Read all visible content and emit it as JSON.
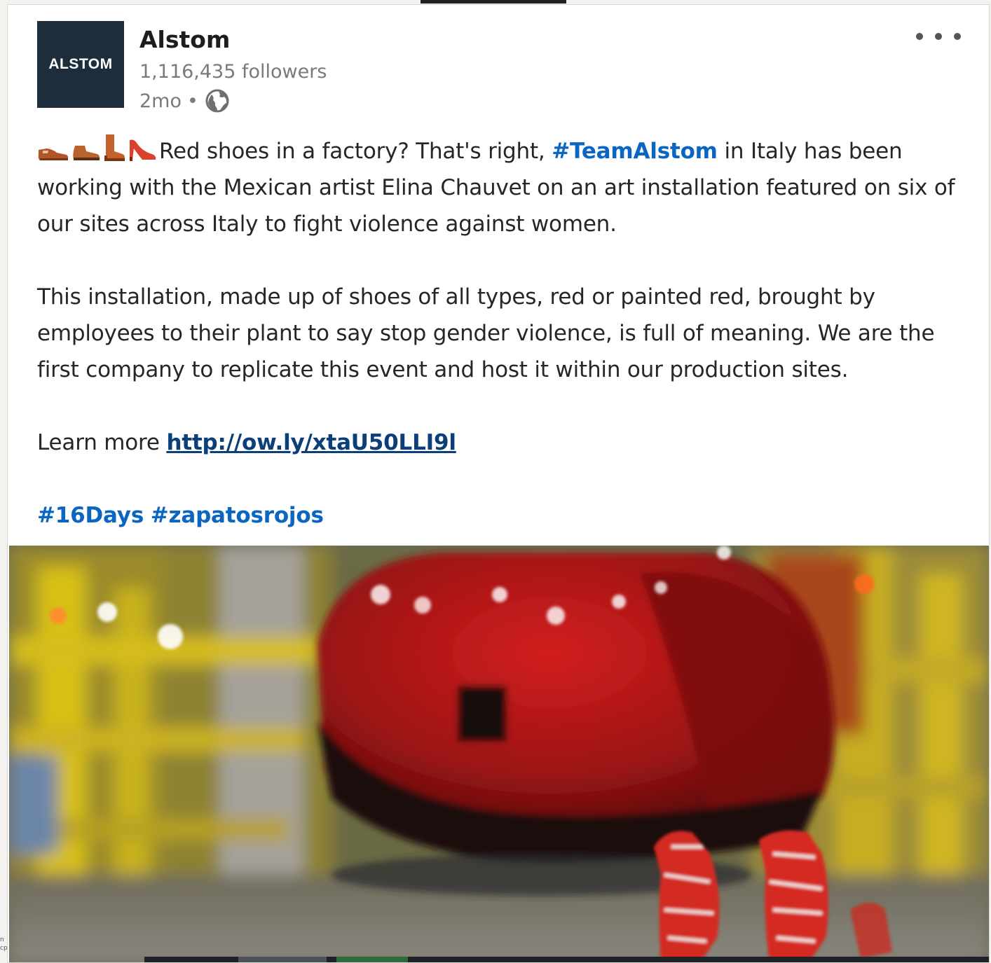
{
  "post": {
    "author": {
      "logo_text": "ALSTOM",
      "name": "Alstom",
      "followers": "1,116,435 followers",
      "time": "2mo",
      "separator": "•",
      "visibility_icon": "globe-icon"
    },
    "more_icon": "more-horizontal-icon",
    "emojis": [
      "mans-shoe",
      "hiking-boot",
      "womans-boot",
      "high-heeled-shoe"
    ],
    "paragraph1": {
      "text_a": "Red shoes in a factory? That's right, ",
      "hashtag": "#TeamAlstom",
      "text_b": " in Italy has been working with the Mexican artist Elina Chauvet on an art installation featured on six of our sites across Italy to fight violence against women."
    },
    "paragraph2": "This installation, made up of shoes of all types, red or painted red, brought by employees to their plant to say stop gender violence, is full of meaning. We are the first company to replicate this event and host it within our production sites.",
    "learn_more": {
      "label": "Learn more ",
      "url_text": "http://ow.ly/xtaU50LLI9l"
    },
    "hashtags": [
      "#16Days",
      "#zapatosrojos"
    ]
  },
  "colors": {
    "brand": "#1e2d3b",
    "hashtag": "#0a66c2",
    "link": "#0a3f7a",
    "text": "#262626",
    "muted": "#7a7a7a"
  },
  "edge_fragments": [
    "n",
    "cp"
  ]
}
